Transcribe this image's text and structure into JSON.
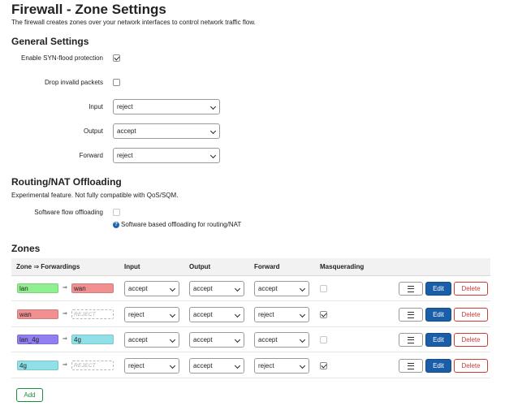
{
  "page": {
    "title": "Firewall - Zone Settings",
    "description": "The firewall creates zones over your network interfaces to control network traffic flow."
  },
  "general": {
    "heading": "General Settings",
    "syn_flood": {
      "label": "Enable SYN-flood protection",
      "checked": true
    },
    "drop_invalid": {
      "label": "Drop invalid packets",
      "checked": false
    },
    "input": {
      "label": "Input",
      "value": "reject"
    },
    "output": {
      "label": "Output",
      "value": "accept"
    },
    "forward": {
      "label": "Forward",
      "value": "reject"
    }
  },
  "offloading": {
    "heading": "Routing/NAT Offloading",
    "note": "Experimental feature. Not fully compatible with QoS/SQM.",
    "sw_offload": {
      "label": "Software flow offloading",
      "checked": false
    },
    "help_icon": "question-circle-icon",
    "help_text": "Software based offloading for routing/NAT"
  },
  "zones": {
    "heading": "Zones",
    "columns": {
      "zone": "Zone ⇒ Forwardings",
      "input": "Input",
      "output": "Output",
      "forward": "Forward",
      "masq": "Masquerading"
    },
    "arrow": "⇒",
    "rows": [
      {
        "zone": "lan",
        "zone_color": "#90f090",
        "fwd": "wan",
        "fwd_color": "#f09090",
        "fwd_reject": false,
        "input": "accept",
        "output": "accept",
        "forward": "accept",
        "masq": false
      },
      {
        "zone": "wan",
        "zone_color": "#f09090",
        "fwd": "REJECT",
        "fwd_color": "#ffffff",
        "fwd_reject": true,
        "input": "reject",
        "output": "accept",
        "forward": "reject",
        "masq": true
      },
      {
        "zone": "lan_4g",
        "zone_color": "#8f7ff0",
        "fwd": "4g",
        "fwd_color": "#90e0e8",
        "fwd_reject": false,
        "input": "accept",
        "output": "accept",
        "forward": "accept",
        "masq": false
      },
      {
        "zone": "4g",
        "zone_color": "#90e0e8",
        "fwd": "REJECT",
        "fwd_color": "#ffffff",
        "fwd_reject": true,
        "input": "reject",
        "output": "accept",
        "forward": "reject",
        "masq": true
      }
    ],
    "menu_icon": "list-icon",
    "edit_label": "Edit",
    "delete_label": "Delete",
    "add_label": "Add"
  }
}
